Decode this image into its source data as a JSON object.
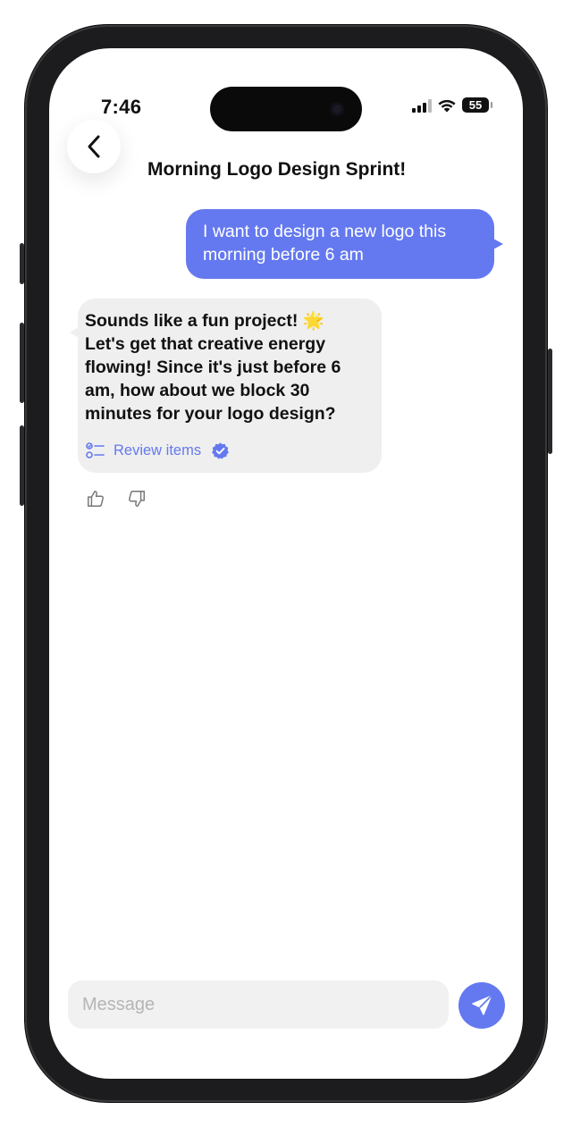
{
  "status_bar": {
    "time": "7:46",
    "battery": "55"
  },
  "header": {
    "title": "Morning Logo Design Sprint!"
  },
  "messages": {
    "user_message": "I want to design a new logo this morning before 6 am",
    "bot_message": "Sounds like a fun project! ",
    "bot_message_cont": "Let's get that creative energy flowing! Since it's just before 6 am, how about we block 30 minutes for your logo design?",
    "bot_emoji": "🌟",
    "review_label": "Review items"
  },
  "composer": {
    "placeholder": "Message"
  },
  "colors": {
    "accent": "#6479f0",
    "bot_bubble": "#efefef",
    "input_bg": "#f1f1f1"
  },
  "icons": {
    "back": "chevron-left-icon",
    "review": "checklist-icon",
    "verified": "verified-badge-icon",
    "thumbs_up": "thumbs-up-icon",
    "thumbs_down": "thumbs-down-icon",
    "send": "paper-plane-icon"
  }
}
